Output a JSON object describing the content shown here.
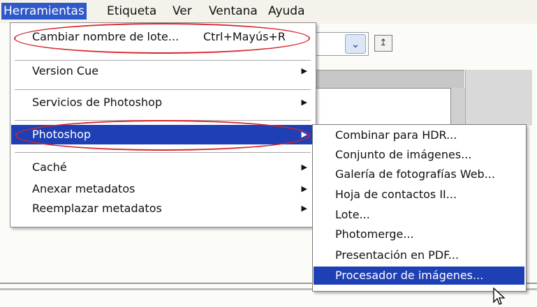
{
  "menubar": {
    "items": [
      "Herramientas",
      "Etiqueta",
      "Ver",
      "Ventana",
      "Ayuda"
    ]
  },
  "menu": {
    "rename_batch": {
      "label": "Cambiar nombre de lote...",
      "shortcut": "Ctrl+Mayús+R"
    },
    "version_cue": "Version Cue",
    "photoshop_services": "Servicios de Photoshop",
    "photoshop": "Photoshop",
    "cache": "Caché",
    "append_metadata": "Anexar metadatos",
    "replace_metadata": "Reemplazar metadatos"
  },
  "submenu": {
    "items": [
      "Combinar para HDR...",
      "Conjunto de imágenes...",
      "Galería de fotografías Web...",
      "Hoja de contactos II...",
      "Lote...",
      "Photomerge...",
      "Presentación en PDF...",
      "Procesador de imágenes..."
    ]
  },
  "colors": {
    "highlight": "#1f3fb5",
    "annotation": "#d8262a"
  }
}
